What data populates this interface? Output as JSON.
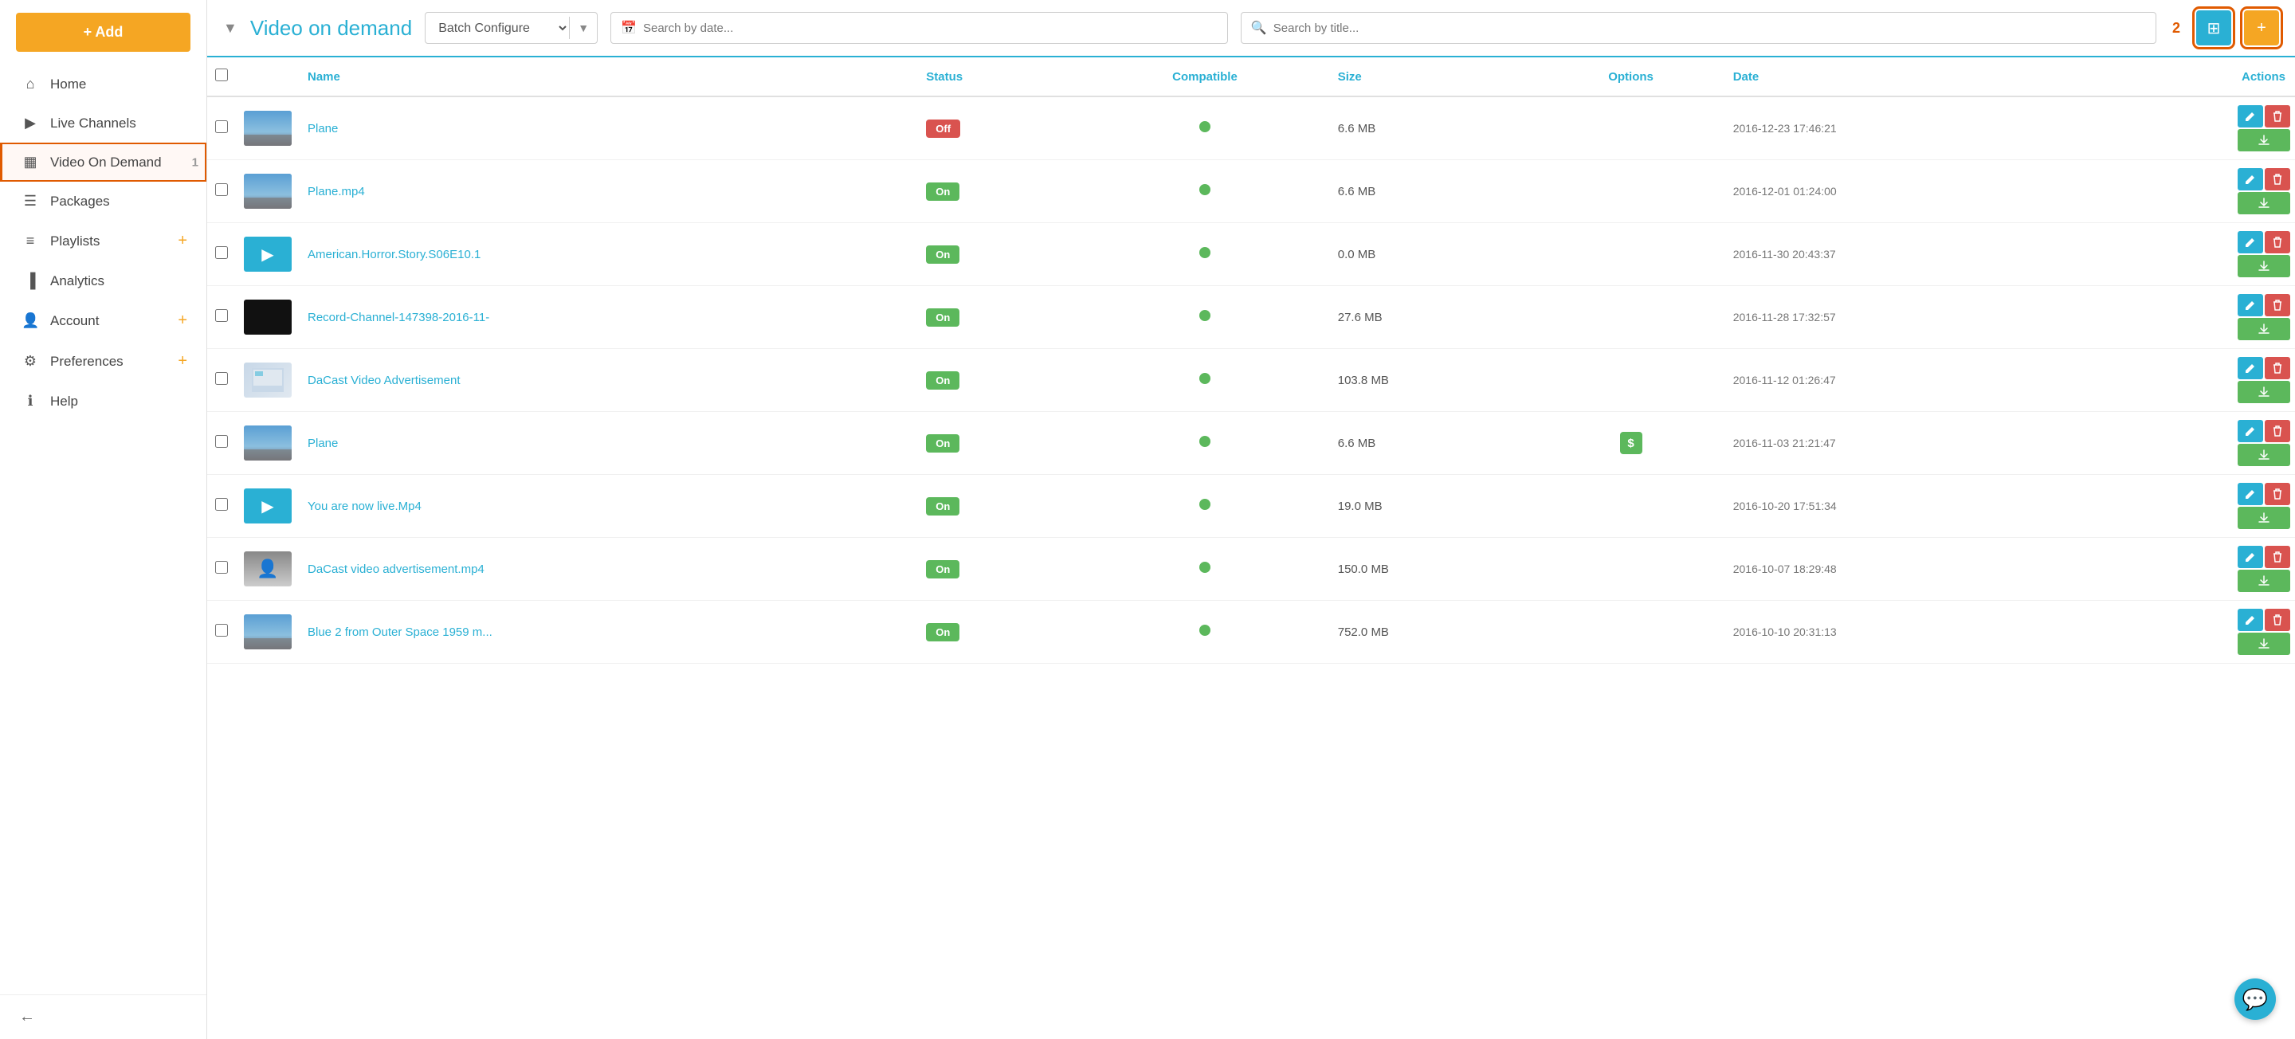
{
  "sidebar": {
    "add_button_label": "+ Add",
    "items": [
      {
        "id": "home",
        "label": "Home",
        "icon": "🏠",
        "active": false,
        "has_plus": false
      },
      {
        "id": "live-channels",
        "label": "Live Channels",
        "icon": "▶",
        "active": false,
        "has_plus": false
      },
      {
        "id": "video-on-demand",
        "label": "Video On Demand",
        "icon": "▦",
        "active": true,
        "has_plus": false,
        "num": "1"
      },
      {
        "id": "packages",
        "label": "Packages",
        "icon": "☰",
        "active": false,
        "has_plus": false
      },
      {
        "id": "playlists",
        "label": "Playlists",
        "icon": "≡+",
        "active": false,
        "has_plus": true
      },
      {
        "id": "analytics",
        "label": "Analytics",
        "icon": "📊",
        "active": false,
        "has_plus": false
      },
      {
        "id": "account",
        "label": "Account",
        "icon": "👤",
        "active": false,
        "has_plus": true
      },
      {
        "id": "preferences",
        "label": "Preferences",
        "icon": "⚙",
        "active": false,
        "has_plus": true
      },
      {
        "id": "help",
        "label": "Help",
        "icon": "ℹ",
        "active": false,
        "has_plus": false
      }
    ],
    "collapse_icon": "←"
  },
  "header": {
    "chevron": "▼",
    "title": "Video on demand",
    "batch_configure": "Batch Configure",
    "date_placeholder": "Search by date...",
    "title_placeholder": "Search by title...",
    "count": "2",
    "grid_icon": "⊞",
    "add_icon": "+"
  },
  "table": {
    "columns": [
      "",
      "",
      "Name",
      "Status",
      "Compatible",
      "Size",
      "Options",
      "Date",
      "Actions"
    ],
    "rows": [
      {
        "id": 1,
        "thumb_type": "sky",
        "name": "Plane",
        "status": "Off",
        "status_class": "off",
        "compatible": true,
        "size": "6.6 MB",
        "options": "",
        "date": "2016-12-23 17:46:21"
      },
      {
        "id": 2,
        "thumb_type": "sky",
        "name": "Plane.mp4",
        "status": "On",
        "status_class": "on",
        "compatible": true,
        "size": "6.6 MB",
        "options": "",
        "date": "2016-12-01 01:24:00"
      },
      {
        "id": 3,
        "thumb_type": "play",
        "name": "American.Horror.Story.S06E10.1",
        "status": "On",
        "status_class": "on",
        "compatible": true,
        "size": "0.0 MB",
        "options": "",
        "date": "2016-11-30 20:43:37"
      },
      {
        "id": 4,
        "thumb_type": "black",
        "name": "Record-Channel-147398-2016-11-",
        "status": "On",
        "status_class": "on",
        "compatible": true,
        "size": "27.6 MB",
        "options": "",
        "date": "2016-11-28 17:32:57"
      },
      {
        "id": 5,
        "thumb_type": "screenshot",
        "name": "DaCast Video Advertisement",
        "status": "On",
        "status_class": "on",
        "compatible": true,
        "size": "103.8 MB",
        "options": "",
        "date": "2016-11-12 01:26:47"
      },
      {
        "id": 6,
        "thumb_type": "sky",
        "name": "Plane",
        "status": "On",
        "status_class": "on",
        "compatible": true,
        "size": "6.6 MB",
        "options": "$",
        "date": "2016-11-03 21:21:47"
      },
      {
        "id": 7,
        "thumb_type": "play",
        "name": "You are now live.Mp4",
        "status": "On",
        "status_class": "on",
        "compatible": true,
        "size": "19.0 MB",
        "options": "",
        "date": "2016-10-20 17:51:34"
      },
      {
        "id": 8,
        "thumb_type": "person",
        "name": "DaCast video advertisement.mp4",
        "status": "On",
        "status_class": "on",
        "compatible": true,
        "size": "150.0 MB",
        "options": "",
        "date": "2016-10-07 18:29:48"
      },
      {
        "id": 9,
        "thumb_type": "sky2",
        "name": "Blue 2 from Outer Space 1959 m...",
        "status": "On",
        "status_class": "on",
        "compatible": true,
        "size": "752.0 MB",
        "options": "",
        "date": "2016-10-10 20:31:13"
      }
    ],
    "action_labels": {
      "edit": "✏",
      "delete": "🗑",
      "download": "⬇"
    }
  },
  "chat": {
    "icon": "💬"
  }
}
